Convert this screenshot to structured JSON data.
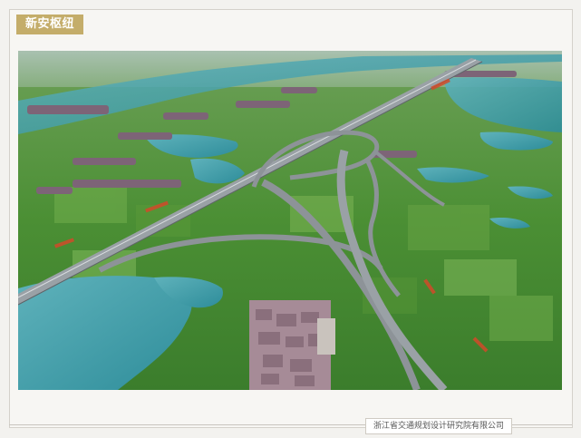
{
  "header": {
    "title": "新安枢纽"
  },
  "footer": {
    "credit": "浙江省交通规划设计研究院有限公司"
  },
  "image": {
    "description_icon": "aerial-interchange-render-icon",
    "colors": {
      "water": "#3d9aa7",
      "field": "#3f8a2f",
      "field_light": "#79b54a",
      "road": "#8c9196",
      "roof": "#7b5a6a"
    }
  }
}
